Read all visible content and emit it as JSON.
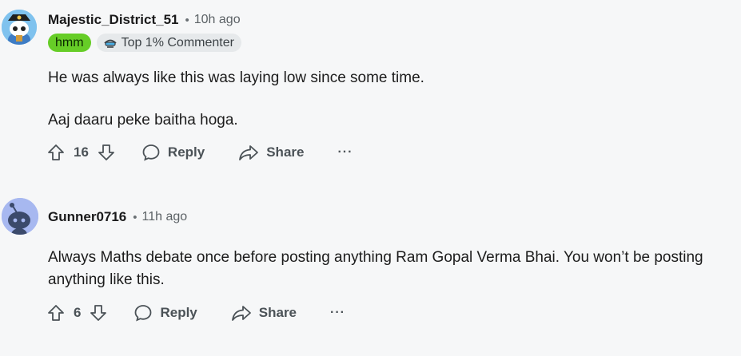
{
  "comments": [
    {
      "username": "Majestic_District_51",
      "separator": "•",
      "time": "10h ago",
      "flair_user": "hmm",
      "flair_badge": "Top 1% Commenter",
      "paragraphs": [
        "He was always like this was laying low since some time.",
        "Aaj daaru peke baitha hoga."
      ],
      "votes": "16",
      "reply_label": "Reply",
      "share_label": "Share",
      "more_label": "···"
    },
    {
      "username": "Gunner0716",
      "separator": "•",
      "time": "11h ago",
      "paragraphs": [
        "Always Maths debate once before posting anything Ram Gopal Verma Bhai. You won’t be posting anything like this."
      ],
      "votes": "6",
      "reply_label": "Reply",
      "share_label": "Share",
      "more_label": "···"
    }
  ],
  "colors": {
    "background": "#f6f7f8",
    "flair_hmm": "#66cd27",
    "flair_badge_bg": "#e6e9eb",
    "avatar2_bg": "#a7b8f0",
    "action_text": "#4b5257"
  },
  "icons": [
    "snoo-avatar-pirate",
    "snoo-avatar-default",
    "top-commenter-icon",
    "upvote-icon",
    "downvote-icon",
    "reply-icon",
    "share-icon",
    "more-icon"
  ]
}
